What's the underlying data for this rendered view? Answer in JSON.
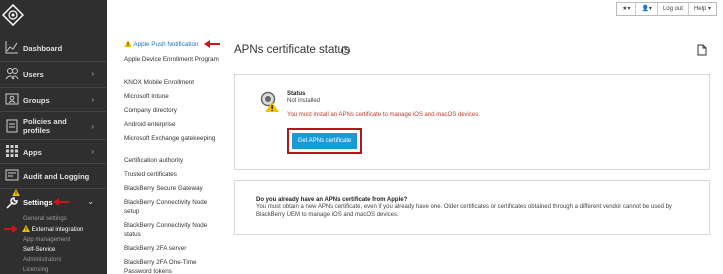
{
  "sidebar": {
    "items": [
      {
        "label": "Dashboard",
        "icon": "line-chart-icon"
      },
      {
        "label": "Users",
        "icon": "users-icon"
      },
      {
        "label": "Groups",
        "icon": "groups-icon"
      },
      {
        "label": "Policies and profiles",
        "icon": "policies-icon"
      },
      {
        "label": "Apps",
        "icon": "apps-grid-icon"
      },
      {
        "label": "Audit and Logging",
        "icon": "audit-icon"
      },
      {
        "label": "Settings",
        "icon": "wrench-icon"
      }
    ],
    "settings_sub": [
      "General settings",
      "External integration",
      "App management",
      "Self-Service",
      "Administrators",
      "Licensing"
    ]
  },
  "submenu": {
    "items": [
      "Apple Push Notification",
      "Apple Device Enrollment Program",
      "KNOX Mobile Enrollment",
      "Microsoft Intune",
      "Company directory",
      "Android enterprise",
      "Microsoft Exchange gatekeeping",
      "Certification authority",
      "Trusted certificates",
      "BlackBerry Secure Gateway",
      "BlackBerry Connectivity Node setup",
      "BlackBerry Connectivity Node status",
      "BlackBerry 2FA server",
      "BlackBerry 2FA One-Time Password tokens"
    ]
  },
  "topbar": {
    "star": "★▾",
    "user": "👤▾",
    "logout": "Log out",
    "help": "Help ▾"
  },
  "main": {
    "title": "APNs certificate status",
    "status_label": "Status",
    "status_value": "Not installed",
    "status_warning": "You must install an APNs certificate to manage iOS and macOS devices.",
    "button_label": "Get APNs certificate",
    "question_title": "Do you already have an APNs certificate from Apple?",
    "question_text": "You must obtain a new APNs certificate, even if you already have one. Older certificates or certificates obtained through a different vendor cannot be used by BlackBerry UEM to manage iOS and macOS devices."
  },
  "colors": {
    "sidebar_bg": "#2f2f2f",
    "accent_blue": "#1a9bd7",
    "highlight_red": "#b0161a",
    "warning_yellow": "#f2c300"
  }
}
